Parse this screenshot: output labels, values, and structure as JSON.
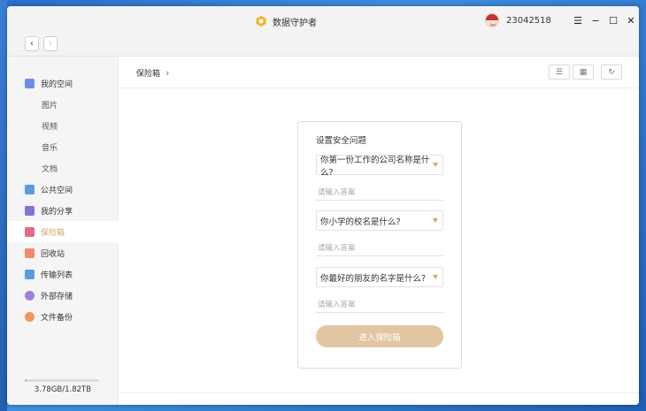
{
  "app": {
    "title": "数据守护者",
    "username": "23042518"
  },
  "window_controls": {
    "menu": "☰",
    "minimize": "−",
    "maximize": "☐",
    "close": "✕"
  },
  "navigation": {
    "back": "‹",
    "forward": "›"
  },
  "sidebar": {
    "items": [
      {
        "label": "我的空间",
        "icon": "my-space-icon",
        "color": "#6c8ee8"
      },
      {
        "label": "图片"
      },
      {
        "label": "视频"
      },
      {
        "label": "音乐"
      },
      {
        "label": "文档"
      },
      {
        "label": "公共空间",
        "icon": "public-space-icon",
        "color": "#5a9be6"
      },
      {
        "label": "我的分享",
        "icon": "share-icon",
        "color": "#8a6fd6"
      },
      {
        "label": "保险箱",
        "icon": "safe-icon",
        "color": "#e46b8a"
      },
      {
        "label": "回收站",
        "icon": "trash-icon",
        "color": "#f08a6c"
      },
      {
        "label": "传输列表",
        "icon": "transfer-icon",
        "color": "#5a9be6"
      },
      {
        "label": "外部存储",
        "icon": "external-storage-icon",
        "color": "#9a80e0"
      },
      {
        "label": "文件备份",
        "icon": "backup-icon",
        "color": "#f0945a"
      }
    ],
    "storage": {
      "text": "3.78GB/1.82TB"
    }
  },
  "main": {
    "breadcrumb": {
      "current": "保险箱",
      "separator": "›"
    },
    "toolbar": {
      "sort_icon": "☰",
      "grid_icon": "▦",
      "refresh_icon": "↻"
    }
  },
  "security_form": {
    "title": "设置安全问题",
    "questions": [
      {
        "question": "你第一份工作的公司名称是什么?",
        "answer_placeholder": "请输入答案"
      },
      {
        "question": "你小学的校名是什么?",
        "answer_placeholder": "请输入答案"
      },
      {
        "question": "你最好的朋友的名字是什么?",
        "answer_placeholder": "请输入答案"
      }
    ],
    "submit_label": "进入保险箱"
  },
  "colors": {
    "accent": "#d4a574",
    "button": "#e2c5a2"
  }
}
